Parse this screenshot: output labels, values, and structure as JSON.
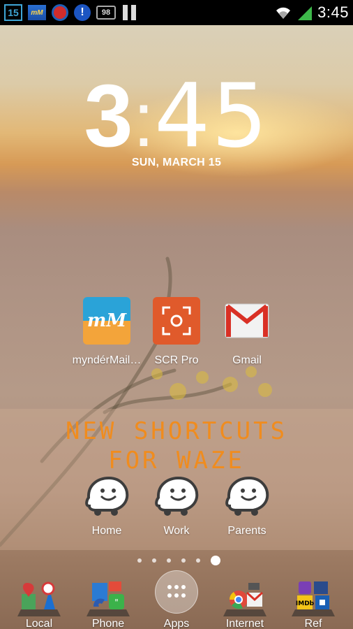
{
  "status_bar": {
    "notification_number": "15",
    "battery_level": "98",
    "time": "3:45",
    "icons": [
      "calendar-15-icon",
      "myndermail-icon",
      "red-circle-app-icon",
      "alert-icon",
      "battery-98-icon",
      "pause-icon",
      "wifi-icon",
      "signal-icon"
    ]
  },
  "clock": {
    "hour": "3",
    "separator": ":",
    "minutes": "45",
    "date": "SUN, MARCH 15"
  },
  "home_apps": [
    {
      "label": "myndérMail…",
      "icon": "myndermail-icon"
    },
    {
      "label": "SCR Pro",
      "icon": "scr-pro-icon"
    },
    {
      "label": "Gmail",
      "icon": "gmail-icon"
    }
  ],
  "waze_widget": {
    "title": "NEW SHORTCUTS\nFOR WAZE",
    "shortcuts": [
      {
        "label": "Home",
        "icon": "waze-icon"
      },
      {
        "label": "Work",
        "icon": "waze-icon"
      },
      {
        "label": "Parents",
        "icon": "waze-icon"
      }
    ]
  },
  "page_indicator": {
    "pages": 6,
    "active": 6
  },
  "dock": [
    {
      "label": "Local",
      "icon": "local-folder-icon"
    },
    {
      "label": "Phone",
      "icon": "phone-folder-icon"
    },
    {
      "label": "Apps",
      "icon": "app-drawer-icon"
    },
    {
      "label": "Internet",
      "icon": "internet-folder-icon"
    },
    {
      "label": "Ref",
      "icon": "ref-folder-icon"
    }
  ],
  "colors": {
    "status_bar_bg": "#000000",
    "waze_title": "#f08c1e",
    "scr_pro": "#e05a2b",
    "waze_outline": "#3d3d3d"
  }
}
